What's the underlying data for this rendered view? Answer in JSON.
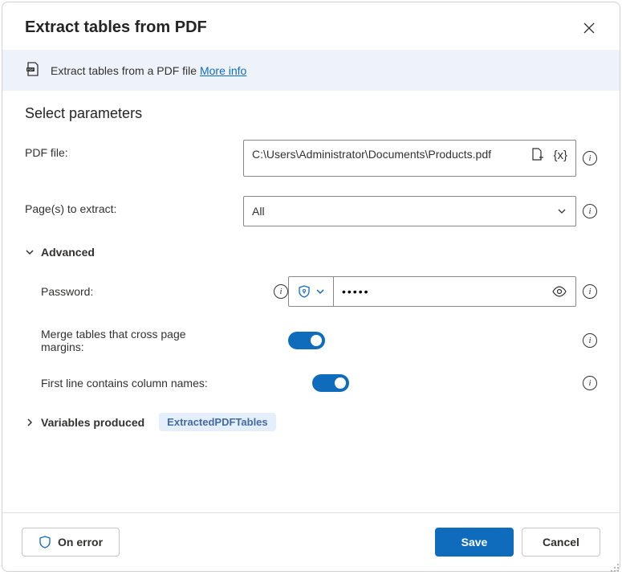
{
  "header": {
    "title": "Extract tables from PDF"
  },
  "banner": {
    "text": "Extract tables from a PDF file ",
    "link": "More info"
  },
  "section_title": "Select parameters",
  "fields": {
    "pdf_file": {
      "label": "PDF file:",
      "value": "C:\\Users\\Administrator\\Documents\\Products.pdf"
    },
    "pages": {
      "label": "Page(s) to extract:",
      "value": "All"
    }
  },
  "advanced": {
    "title": "Advanced",
    "password": {
      "label": "Password:",
      "masked": "•••••"
    },
    "merge": {
      "label": "Merge tables that cross page margins:",
      "on": true
    },
    "firstline": {
      "label": "First line contains column names:",
      "on": true
    }
  },
  "variables": {
    "title": "Variables produced",
    "badge": "ExtractedPDFTables"
  },
  "footer": {
    "on_error": "On error",
    "save": "Save",
    "cancel": "Cancel"
  }
}
